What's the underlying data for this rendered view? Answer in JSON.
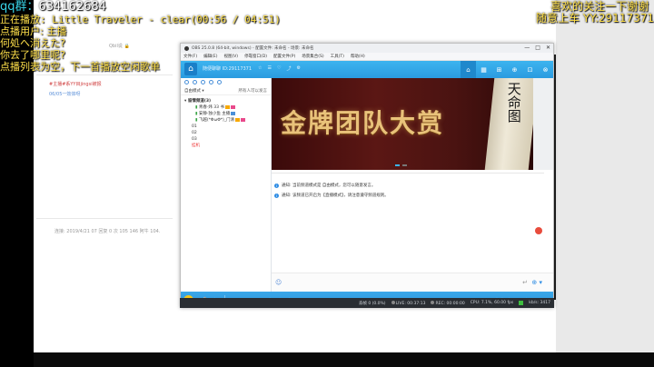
{
  "overlay": {
    "qq_prefix": "qq群：",
    "qq_number": "634162684",
    "now_playing": "正在播放: Little Traveler - clear(00:56 / 04:51)",
    "requester": "点播用户: 主播",
    "lyric1": "何処へ消えた?",
    "lyric2": "你去了哪里呢?",
    "queue_note": "点播列表为空，下一首播放空闲歌单",
    "right1": "喜欢的关注一下谢谢",
    "right2": "随意上车 YY:29117371"
  },
  "background_app": {
    "lines": [
      {
        "text": "Qbil说 🔒",
        "style": "gray"
      },
      {
        "text": "#主播#系YY目jingsi被报",
        "style": "red"
      },
      {
        "text": "06/05一效体呀",
        "style": "blue"
      },
      {
        "text": "连接: 2019/4/21 07  回复 0 次  105 146  阿牛 104.",
        "style": "gray"
      }
    ]
  },
  "yy_window": {
    "title": "OBS 25.0.8 (64-bit, windows) - 配置文件: 未命名 - 场景: 未命名",
    "menu": [
      "文件(F)",
      "编辑(E)",
      "视图(V)",
      "停靠窗口(D)",
      "配置文件(P)",
      "场景集合(S)",
      "工具(T)",
      "帮助(H)"
    ],
    "window_controls": [
      "—",
      "□",
      "✕"
    ],
    "header": {
      "channel_name": "随便聊聊 ID:29117371",
      "header_icons": [
        "☆",
        "☰",
        "♡",
        "⤴",
        "⚙"
      ],
      "right_icons": [
        "⌂",
        "▦",
        "⊞",
        "⊕",
        "⊡",
        "⊗"
      ]
    },
    "left": {
      "mode_label": "自由模式 ▾",
      "mode_link": "所有人可以发言",
      "tree": [
        {
          "text": "▾ 留情频道(3)",
          "type": "group"
        },
        {
          "text": "青春·炜 33 书",
          "type": "sub"
        },
        {
          "text": "安静·独小鱼 主播",
          "type": "sub"
        },
        {
          "text": "飞越(*ΦωΦ*)_门清",
          "type": "sub"
        },
        {
          "text": "01",
          "type": "ch"
        },
        {
          "text": "02",
          "type": "ch"
        },
        {
          "text": "03",
          "type": "ch"
        },
        {
          "text": "挂机",
          "type": "ch-red"
        }
      ]
    },
    "banner": {
      "headline": "金牌团队大赏",
      "scroll_text": "天命图"
    },
    "notices": [
      "通知: 当前频道模式是 自由模式，您可以随意发言。",
      "通知: 该频道已开启为【直播模式】，请注意遵守频道规则。"
    ],
    "input": {
      "smile_icon": "smile-icon",
      "enter_label": "↵",
      "send_label": "⊕ ▾"
    },
    "bottom_bar": {
      "items": [
        {
          "icon": "☺",
          "label": ""
        },
        {
          "icon": "♫",
          "label": ""
        },
        {
          "icon": "⊙",
          "label": "自由发言"
        },
        {
          "icon": "♪",
          "label": "播放伴奏"
        },
        {
          "icon": "◎",
          "label": "录音"
        }
      ],
      "right_items": [
        "频道模板 ▾",
        "应用中心 ▾"
      ]
    }
  },
  "obs_status": {
    "dropped": "丢帧 0 (0.0%)",
    "live": "LIVE: 00:37:13",
    "rec": "REC: 00:00:00",
    "cpu": "CPU: 7.1%, 60.00 fps",
    "kbps": "kb/s: 3417"
  }
}
